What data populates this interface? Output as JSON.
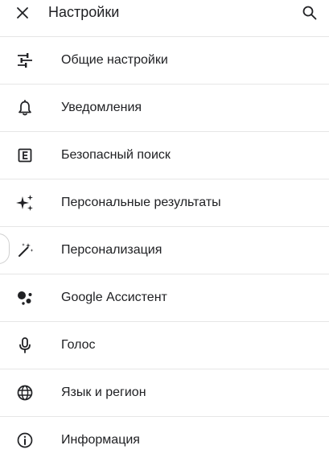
{
  "header": {
    "title": "Настройки",
    "close_icon": "close-icon",
    "search_icon": "search-icon"
  },
  "menu": {
    "items": [
      {
        "label": "Общие настройки",
        "icon": "tune-icon"
      },
      {
        "label": "Уведомления",
        "icon": "bell-icon"
      },
      {
        "label": "Безопасный поиск",
        "icon": "explicit-icon"
      },
      {
        "label": "Персональные результаты",
        "icon": "sparkle-icon"
      },
      {
        "label": "Персонализация",
        "icon": "magic-wand-icon"
      },
      {
        "label": "Google Ассистент",
        "icon": "assistant-icon"
      },
      {
        "label": "Голос",
        "icon": "microphone-icon"
      },
      {
        "label": "Язык и регион",
        "icon": "globe-icon"
      },
      {
        "label": "Информация",
        "icon": "info-icon"
      }
    ]
  },
  "colors": {
    "text": "#202124",
    "icon": "#202124",
    "divider": "#e6e6e6",
    "background": "#ffffff"
  }
}
